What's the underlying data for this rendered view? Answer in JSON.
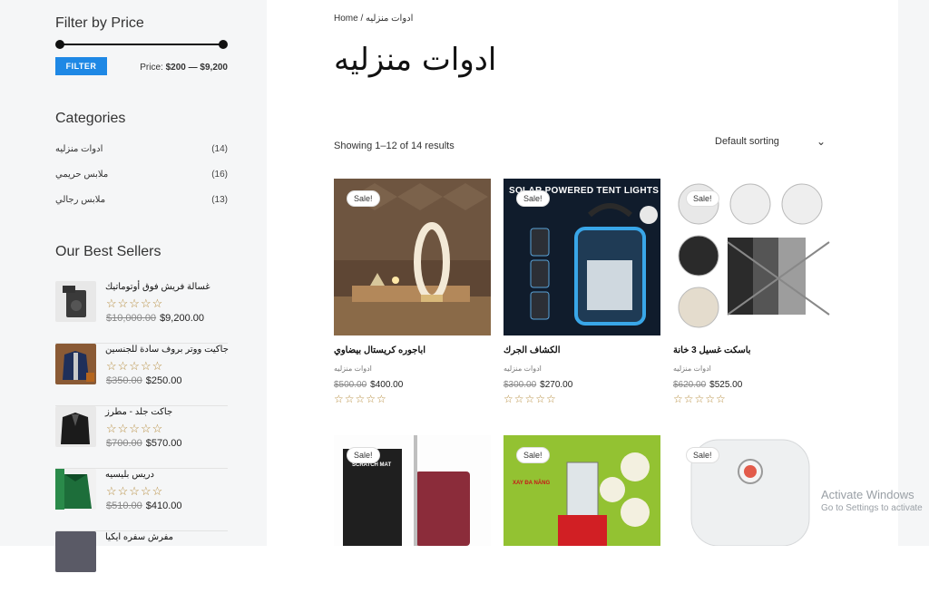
{
  "sidebar": {
    "filter_title": "Filter by Price",
    "filter_button": "FILTER",
    "price_prefix": "Price:",
    "price_range": "$200 — $9,200",
    "categories_title": "Categories",
    "categories": [
      {
        "name": "ادوات منزليه",
        "count": "(14)"
      },
      {
        "name": "ملابس حريمي",
        "count": "(16)"
      },
      {
        "name": "ملابس رجالي",
        "count": "(13)"
      }
    ],
    "best_sellers_title": "Our Best Sellers",
    "best_sellers": [
      {
        "title": "غسالة فريش فوق أوتوماتيك",
        "stars": "☆☆☆☆☆",
        "old": "$10,000.00",
        "new": "$9,200.00"
      },
      {
        "title": "جاكيت ووتر بروف سادة للجنسين",
        "stars": "☆☆☆☆☆",
        "old": "$350.00",
        "new": "$250.00"
      },
      {
        "title": "جاكت جلد - مطرز",
        "stars": "☆☆☆☆☆",
        "old": "$700.00",
        "new": "$570.00"
      },
      {
        "title": "دريس بليسيه",
        "stars": "☆☆☆☆☆",
        "old": "$510.00",
        "new": "$410.00"
      },
      {
        "title": "مفرش سفره ايكيا",
        "stars": "",
        "old": "",
        "new": ""
      }
    ]
  },
  "main": {
    "breadcrumb_home": "Home",
    "breadcrumb_sep": " / ",
    "breadcrumb_current": "ادوات منزليه",
    "title": "ادوات منزليه",
    "results": "Showing 1–12 of 14 results",
    "sorting": "Default sorting",
    "sale_badge": "Sale!",
    "products": [
      {
        "name": "اباجوره كريستال بيضاوي",
        "category": "ادوات منزليه",
        "old": "$500.00",
        "new": "$400.00",
        "stars": "☆☆☆☆☆",
        "image_text": ""
      },
      {
        "name": "الكشاف الجرك",
        "category": "ادوات منزليه",
        "old": "$300.00",
        "new": "$270.00",
        "stars": "☆☆☆☆☆",
        "image_text": "SOLAR POWERED TENT LIGHTS"
      },
      {
        "name": "باسكت غسيل 3 خانة",
        "category": "ادوات منزليه",
        "old": "$620.00",
        "new": "$525.00",
        "stars": "☆☆☆☆☆",
        "image_text": ""
      },
      {
        "name": "",
        "category": "",
        "old": "",
        "new": "",
        "stars": "",
        "image_text": "SCRATCH MAT"
      },
      {
        "name": "",
        "category": "",
        "old": "",
        "new": "",
        "stars": "",
        "image_text": "XAY ĐA NĂNG"
      },
      {
        "name": "",
        "category": "",
        "old": "",
        "new": "",
        "stars": "",
        "image_text": ""
      }
    ]
  },
  "watermark": {
    "line1": "Activate Windows",
    "line2": "Go to Settings to activate"
  },
  "colors": {
    "accent": "#1e88e5",
    "star": "#b58a3a"
  }
}
